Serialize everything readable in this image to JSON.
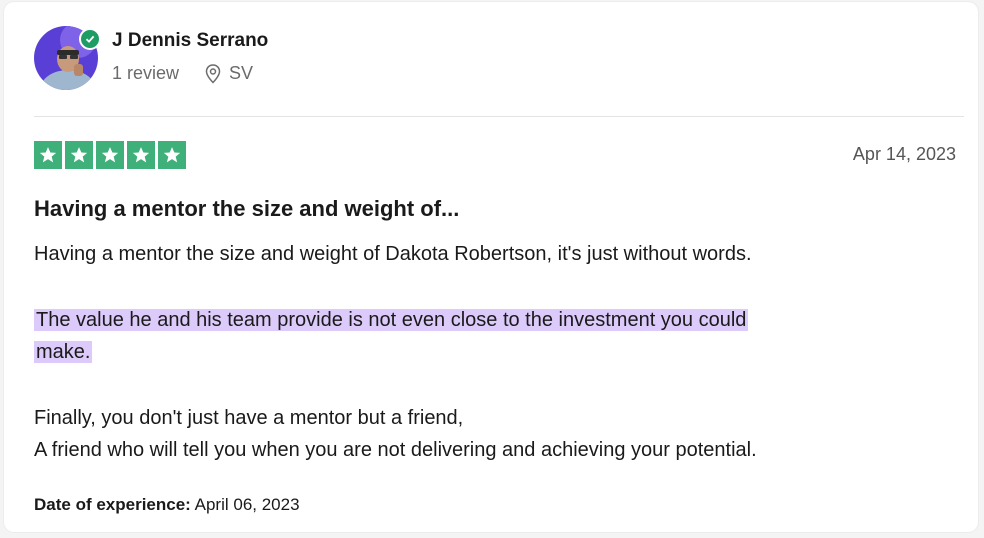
{
  "reviewer": {
    "name": "J Dennis Serrano",
    "review_count": "1 review",
    "location": "SV"
  },
  "review": {
    "rating": 5,
    "star_color": "#3fb07a",
    "date": "Apr 14, 2023",
    "title": "Having a mentor the size and weight of...",
    "paragraph1": "Having a mentor the size and weight of Dakota Robertson, it's just without words.",
    "highlight_line1": "The value he and his team provide is not even close to the investment you could",
    "highlight_line2": "make.",
    "highlight_color": "#dccbfa",
    "paragraph3_line1": "Finally, you don't just have a mentor but a friend,",
    "paragraph3_line2": "A friend who will tell you when you are not delivering and achieving your potential.",
    "experience_label": "Date of experience:",
    "experience_date": "April 06, 2023"
  },
  "icons": {
    "verified": "verified-check-icon",
    "location": "location-pin-icon",
    "star": "star-icon"
  }
}
